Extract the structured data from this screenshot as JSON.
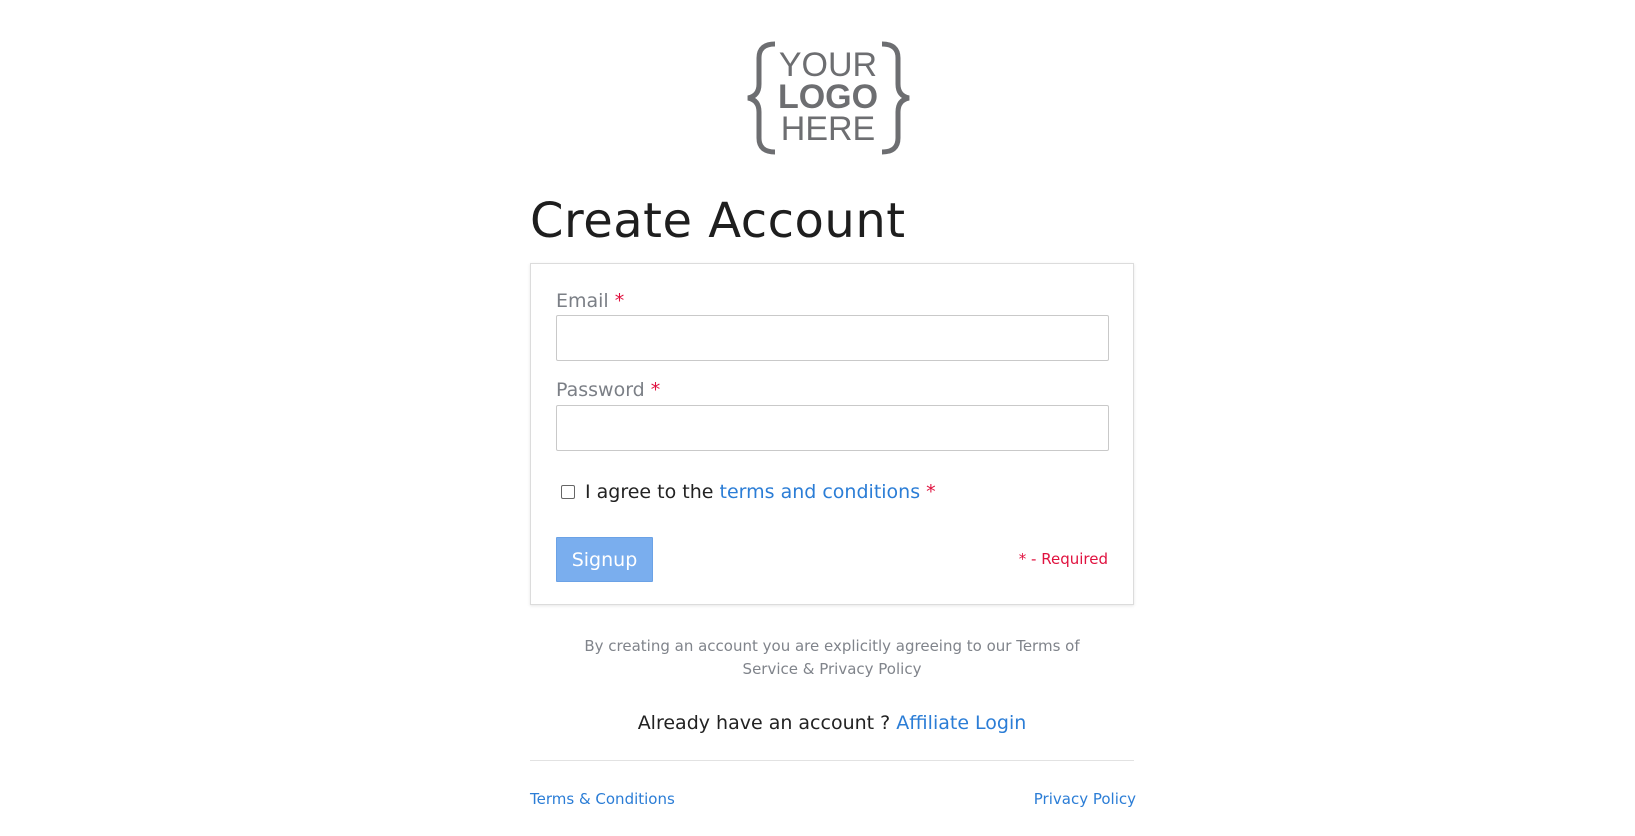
{
  "logo": {
    "line1": "YOUR",
    "line2": "LOGO",
    "line3": "HERE"
  },
  "page_title": "Create Account",
  "form": {
    "email_label": "Email",
    "email_value": "",
    "password_label": "Password",
    "password_value": "",
    "required_marker": "*",
    "agree_prefix": "I agree to the",
    "agree_link": "terms and conditions",
    "signup_label": "Signup",
    "required_note": "* - Required"
  },
  "disclaimer": "By creating an account you are explicitly agreeing to our Terms of Service & Privacy Policy",
  "login_prompt": {
    "text": "Already have an account ?",
    "link": "Affiliate Login"
  },
  "footer": {
    "terms": "Terms & Conditions",
    "privacy": "Privacy Policy"
  },
  "colors": {
    "link": "#2b7dd6",
    "required": "#e0123f",
    "button": "#7aaeee",
    "logo": "#6d6e71"
  }
}
